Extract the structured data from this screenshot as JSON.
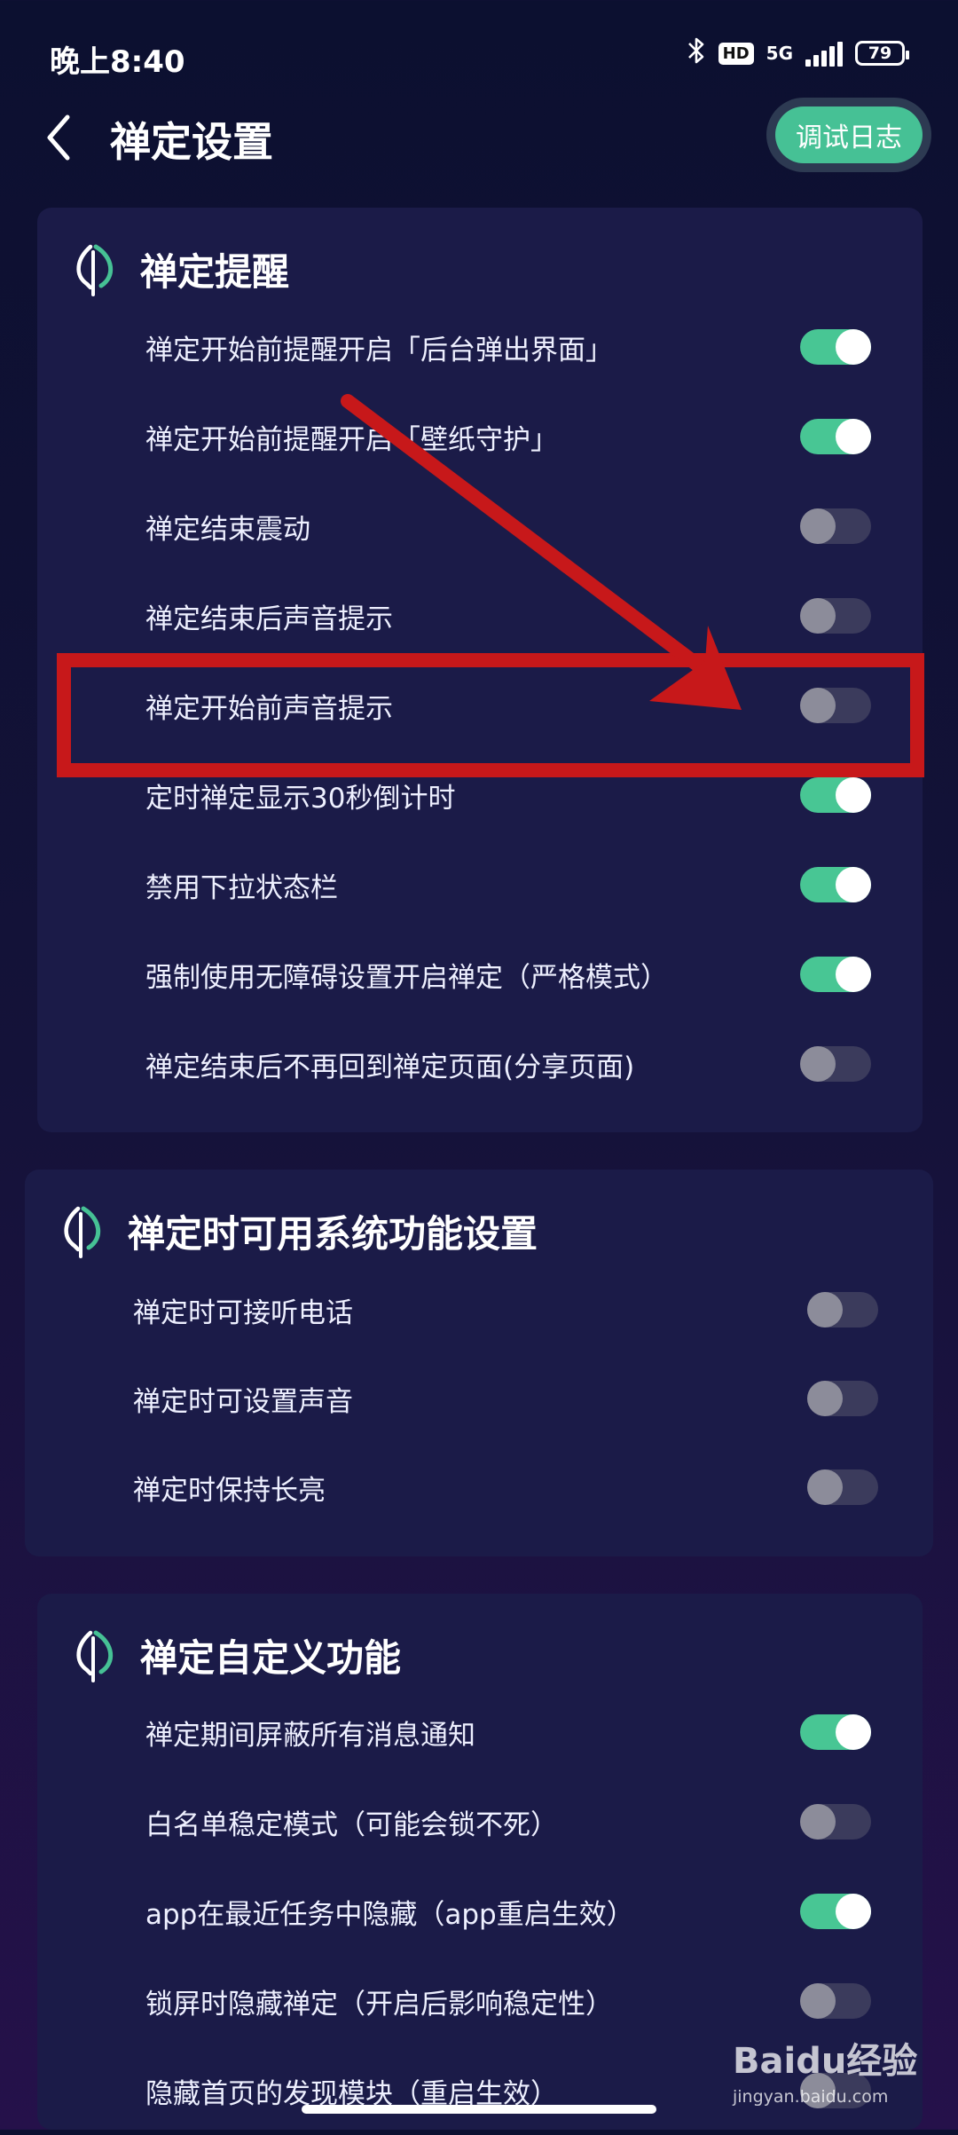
{
  "status_bar": {
    "time": "晚上8:40",
    "hd": "HD",
    "network": "5G",
    "battery": "79"
  },
  "header": {
    "title": "禅定设置",
    "debug_button": "调试日志"
  },
  "sections": [
    {
      "title": "禅定提醒",
      "items": [
        {
          "label": "禅定开始前提醒开启「后台弹出界面」",
          "on": true
        },
        {
          "label": "禅定开始前提醒开启「壁纸守护」",
          "on": true
        },
        {
          "label": "禅定结束震动",
          "on": false
        },
        {
          "label": "禅定结束后声音提示",
          "on": false
        },
        {
          "label": "禅定开始前声音提示",
          "on": false
        },
        {
          "label": "定时禅定显示30秒倒计时",
          "on": true
        },
        {
          "label": "禁用下拉状态栏",
          "on": true
        },
        {
          "label": "强制使用无障碍设置开启禅定（严格模式）",
          "on": true
        },
        {
          "label": "禅定结束后不再回到禅定页面(分享页面)",
          "on": false
        }
      ]
    },
    {
      "title": "禅定时可用系统功能设置",
      "items": [
        {
          "label": "禅定时可接听电话",
          "on": false
        },
        {
          "label": "禅定时可设置声音",
          "on": false
        },
        {
          "label": "禅定时保持长亮",
          "on": false
        }
      ]
    },
    {
      "title": "禅定自定义功能",
      "items": [
        {
          "label": "禅定期间屏蔽所有消息通知",
          "on": true
        },
        {
          "label": "白名单稳定模式（可能会锁不死）",
          "on": false
        },
        {
          "label": "app在最近任务中隐藏（app重启生效）",
          "on": true
        },
        {
          "label": "锁屏时隐藏禅定（开启后影响稳定性）",
          "on": false
        },
        {
          "label": "隐藏首页的发现模块（重启生效）",
          "on": false
        }
      ]
    }
  ],
  "colors": {
    "toggle_on": "#48c694",
    "toggle_off": "#3b3b5c",
    "accent": "#46c195",
    "annotation": "#c7181a"
  },
  "watermark": {
    "logo": "Baidu经验",
    "url": "jingyan.baidu.com"
  }
}
